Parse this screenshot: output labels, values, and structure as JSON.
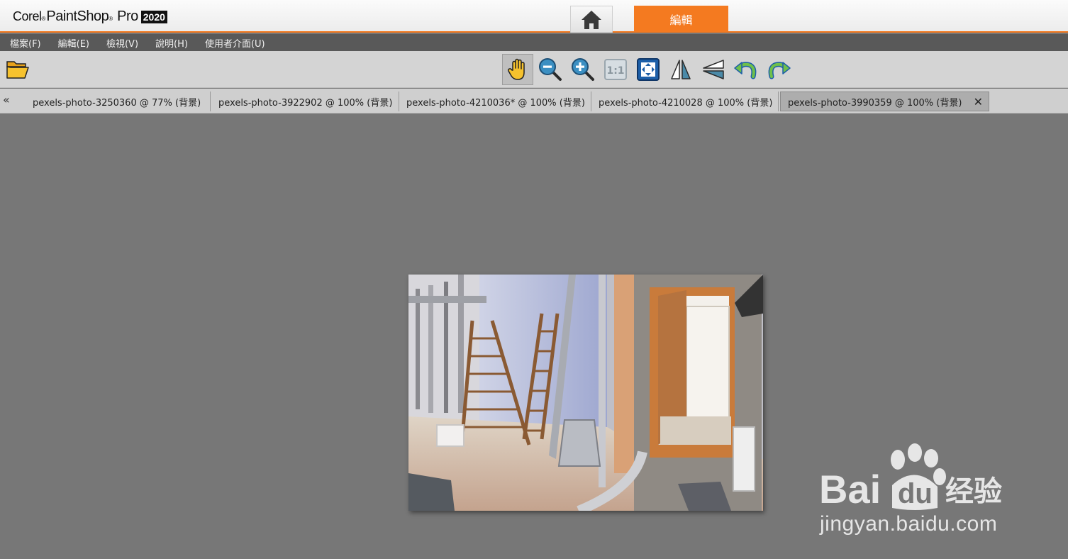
{
  "app": {
    "logo_corel": "Corel",
    "logo_paintshop": "PaintShop",
    "logo_pro": "Pro",
    "logo_year": "2020",
    "home_tab_icon": "home-icon",
    "edit_tab_label": "編輯"
  },
  "menu": {
    "items": [
      "檔案(F)",
      "編輯(E)",
      "檢視(V)",
      "說明(H)",
      "使用者介面(U)"
    ]
  },
  "toolbar": {
    "tools": [
      "open-folder-icon",
      "pan-hand-icon",
      "zoom-out-icon",
      "zoom-in-icon",
      "actual-size-icon",
      "fit-window-icon",
      "flip-horizontal-icon",
      "flip-vertical-icon",
      "rotate-left-icon",
      "rotate-right-icon"
    ],
    "actual_size_label": "1:1"
  },
  "tabs": {
    "scroll_left": "«",
    "items": [
      {
        "label": "pexels-photo-3250360 @  77% (背景)",
        "active": false
      },
      {
        "label": "pexels-photo-3922902 @ 100% (背景)",
        "active": false
      },
      {
        "label": "pexels-photo-4210036* @ 100% (背景)",
        "active": false
      },
      {
        "label": "pexels-photo-4210028 @ 100% (背景)",
        "active": false
      },
      {
        "label": "pexels-photo-3990359 @ 100% (背景)",
        "active": true
      }
    ],
    "close_glyph": "✕"
  },
  "watermark": {
    "brand": "Baidu 经验",
    "url": "jingyan.baidu.com"
  },
  "colors": {
    "accent": "#f47a20",
    "menubar": "#595959",
    "toolbar": "#d4d4d4",
    "canvas": "#777777"
  }
}
